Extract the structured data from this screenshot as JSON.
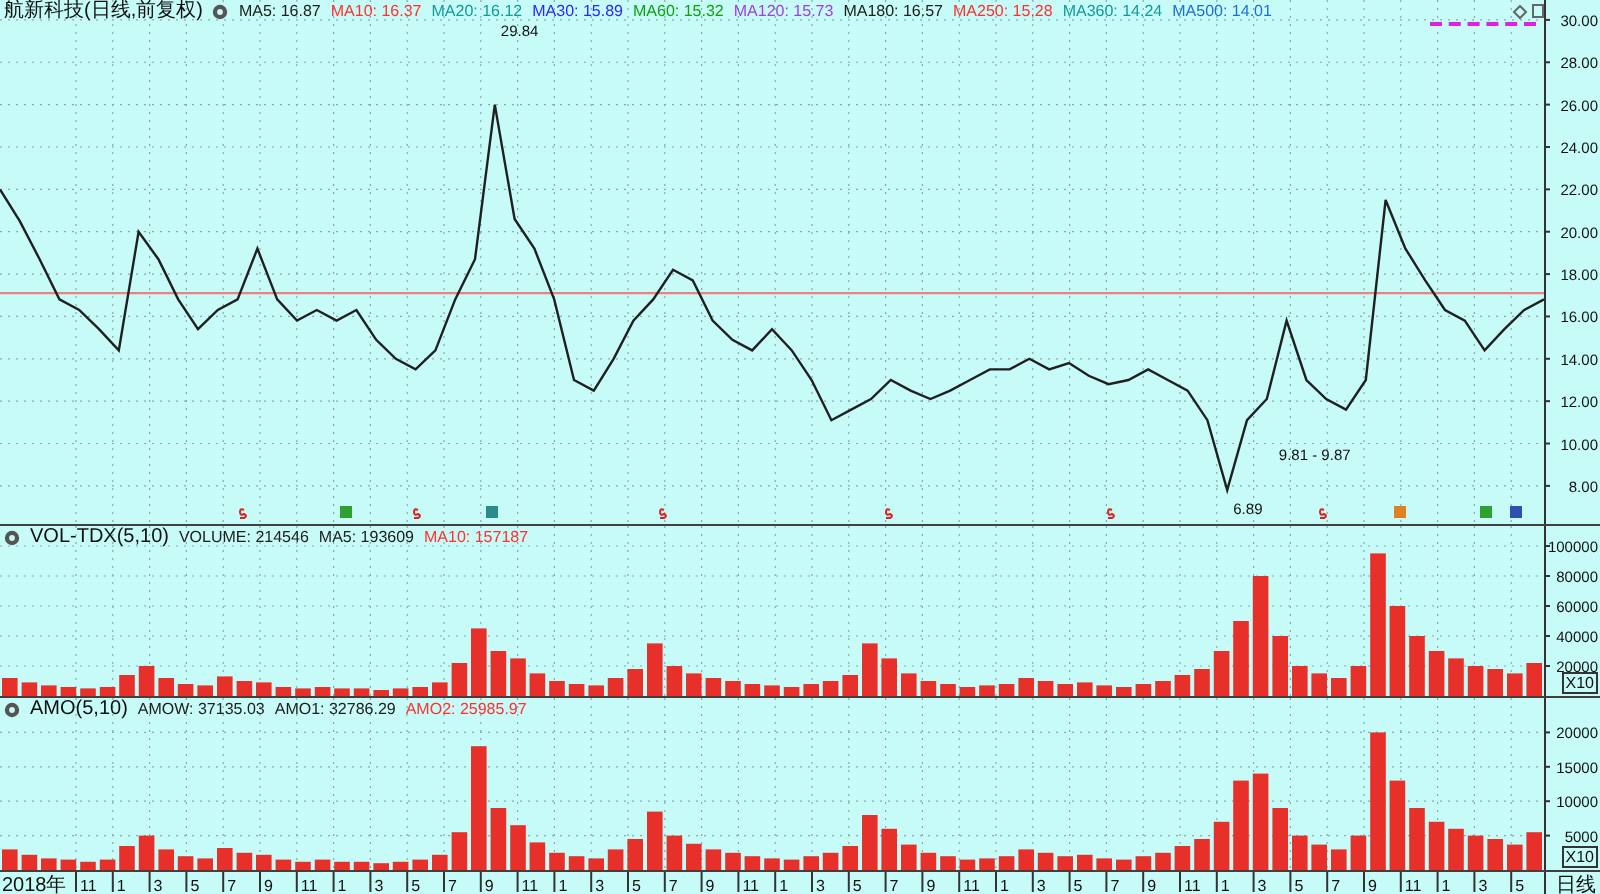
{
  "price_pane": {
    "title": "航新科技(日线,前复权)",
    "legend": [
      {
        "text": "MA5: 16.87",
        "color": "#202020"
      },
      {
        "text": "MA10: 16.37",
        "color": "#ff3030"
      },
      {
        "text": "MA20: 16.12",
        "color": "#109a9a"
      },
      {
        "text": "MA30: 15.89",
        "color": "#2828ff"
      },
      {
        "text": "MA60: 15.32",
        "color": "#10a010"
      },
      {
        "text": "MA120: 15.73",
        "color": "#a040e0"
      },
      {
        "text": "MA180: 16.57",
        "color": "#202020"
      },
      {
        "text": "MA250: 15.28",
        "color": "#ff3030"
      },
      {
        "text": "MA360: 14.24",
        "color": "#109a9a"
      },
      {
        "text": "MA500: 14.01",
        "color": "#2070d0"
      }
    ],
    "chart_data": {
      "type": "line",
      "grid": true,
      "ylim": [
        6.2,
        30.94
      ],
      "yticks": [
        {
          "value": 30,
          "label": "30.00"
        },
        {
          "value": 28,
          "label": "28.00"
        },
        {
          "value": 26,
          "label": "26.00"
        },
        {
          "value": 24,
          "label": "24.00"
        },
        {
          "value": 22,
          "label": "22.00"
        },
        {
          "value": 20,
          "label": "20.00"
        },
        {
          "value": 18,
          "label": "18.00"
        },
        {
          "value": 16,
          "label": "16.00"
        },
        {
          "value": 14,
          "label": "14.00"
        },
        {
          "value": 12,
          "label": "12.00"
        },
        {
          "value": 10,
          "label": "10.00"
        },
        {
          "value": 8,
          "label": "8.00"
        }
      ],
      "series": [
        {
          "color": "#202020",
          "values": [
            22,
            20.5,
            18.7,
            16.8,
            16.3,
            15.4,
            14.4,
            20,
            18.7,
            16.8,
            15.4,
            16.3,
            16.8,
            19.2,
            16.8,
            15.8,
            16.3,
            15.8,
            16.3,
            14.9,
            14,
            13.5,
            14.4,
            16.8,
            18.7,
            26,
            20.6,
            19.2,
            16.8,
            13,
            12.5,
            14,
            15.8,
            16.8,
            18.2,
            17.7,
            15.8,
            14.9,
            14.4,
            15.4,
            14.4,
            13,
            11.1,
            11.6,
            12.1,
            13,
            12.5,
            12.1,
            12.5,
            13,
            13.5,
            13.5,
            14,
            13.5,
            13.8,
            13.2,
            12.8,
            13,
            13.5,
            13,
            12.5,
            11.1,
            7.8,
            11.1,
            12.1,
            15.8,
            13,
            12.1,
            11.6,
            13,
            21.5,
            19.2,
            17.7,
            16.3,
            15.8,
            14.4,
            15.4,
            16.3,
            16.8
          ]
        }
      ],
      "annotations": [
        "29.84",
        "6.89",
        "9.81 - 9.87"
      ],
      "ref_lines": [
        {
          "axis": "y",
          "value": 17.1,
          "color": "#f08080"
        }
      ]
    }
  },
  "volume_pane": {
    "title": "VOL-TDX(5,10)",
    "legend": [
      {
        "text": "VOLUME: 214546",
        "color": "#202020"
      },
      {
        "text": "MA5: 193609",
        "color": "#202020"
      },
      {
        "text": "MA10: 157187",
        "color": "#ff3030"
      }
    ],
    "scale_label": "X10",
    "chart_data": {
      "type": "bar",
      "grid": true,
      "ylim": [
        0,
        113333
      ],
      "yticks": [
        {
          "value": 100000,
          "label": "100000"
        },
        {
          "value": 80000,
          "label": "80000"
        },
        {
          "value": 60000,
          "label": "60000"
        },
        {
          "value": 40000,
          "label": "40000"
        },
        {
          "value": 20000,
          "label": "20000"
        }
      ],
      "series": [
        {
          "color": "#e8302a",
          "values": [
            12000,
            9000,
            7000,
            6000,
            5000,
            6000,
            14000,
            20000,
            12000,
            8000,
            7000,
            13000,
            10000,
            9000,
            6000,
            5000,
            6000,
            5000,
            5000,
            4000,
            5000,
            6000,
            9000,
            22000,
            45000,
            30000,
            25000,
            15000,
            10000,
            8000,
            7000,
            12000,
            18000,
            35000,
            20000,
            15000,
            12000,
            10000,
            8000,
            7000,
            6000,
            8000,
            10000,
            14000,
            35000,
            25000,
            15000,
            10000,
            8000,
            6000,
            7000,
            8000,
            12000,
            10000,
            8000,
            9000,
            7000,
            6000,
            8000,
            10000,
            14000,
            18000,
            30000,
            50000,
            80000,
            40000,
            20000,
            15000,
            12000,
            20000,
            95000,
            60000,
            40000,
            30000,
            25000,
            20000,
            18000,
            15000,
            22000
          ]
        }
      ]
    }
  },
  "amo_pane": {
    "title": "AMO(5,10)",
    "legend": [
      {
        "text": "AMOW: 37135.03",
        "color": "#202020"
      },
      {
        "text": "AMO1: 32786.29",
        "color": "#202020"
      },
      {
        "text": "AMO2: 25985.97",
        "color": "#ff3030"
      }
    ],
    "scale_label": "X10",
    "chart_data": {
      "type": "bar",
      "grid": true,
      "ylim": [
        0,
        25000
      ],
      "yticks": [
        {
          "value": 20000,
          "label": "20000"
        },
        {
          "value": 15000,
          "label": "15000"
        },
        {
          "value": 10000,
          "label": "10000"
        },
        {
          "value": 5000,
          "label": "5000"
        }
      ],
      "series": [
        {
          "color": "#e8302a",
          "values": [
            3000,
            2200,
            1700,
            1500,
            1200,
            1500,
            3500,
            5000,
            3000,
            2000,
            1700,
            3200,
            2500,
            2200,
            1500,
            1200,
            1500,
            1200,
            1200,
            1000,
            1200,
            1500,
            2200,
            5500,
            18000,
            9000,
            6500,
            4000,
            2500,
            2000,
            1700,
            3000,
            4500,
            8500,
            5000,
            3800,
            3000,
            2500,
            2000,
            1700,
            1500,
            2000,
            2500,
            3500,
            8000,
            6000,
            3700,
            2500,
            2000,
            1500,
            1700,
            2000,
            3000,
            2500,
            2000,
            2200,
            1700,
            1500,
            2000,
            2500,
            3500,
            4500,
            7000,
            13000,
            14000,
            9000,
            5000,
            3700,
            3000,
            5000,
            20000,
            13000,
            9000,
            7000,
            6000,
            5000,
            4500,
            3700,
            5500
          ]
        }
      ]
    }
  },
  "time_axis": {
    "labels": [
      "2018年",
      "11",
      "1",
      "3",
      "5",
      "7",
      "9",
      "11",
      "1",
      "3",
      "5",
      "7",
      "9",
      "11",
      "1",
      "3",
      "5",
      "7",
      "9",
      "11",
      "1",
      "3",
      "5",
      "7",
      "9",
      "11",
      "1",
      "3",
      "5",
      "7",
      "9",
      "11",
      "1",
      "3",
      "5",
      "7",
      "9",
      "11",
      "1",
      "3",
      "5"
    ],
    "period": "日线"
  }
}
